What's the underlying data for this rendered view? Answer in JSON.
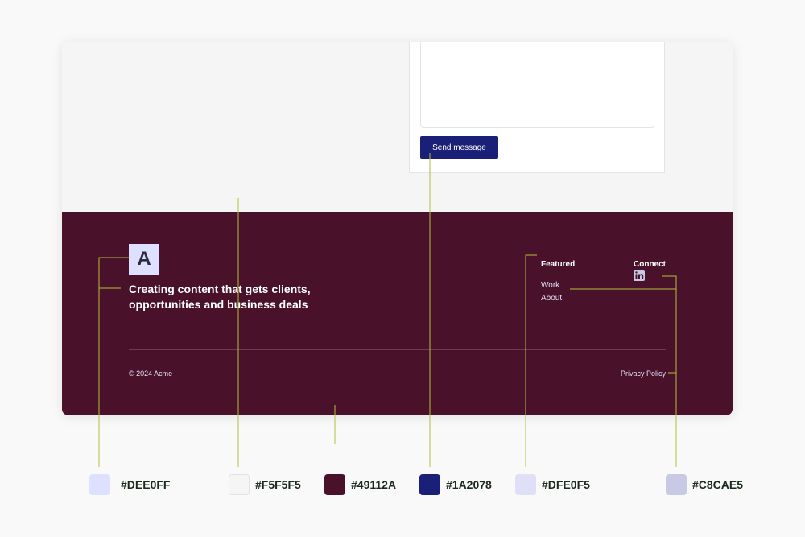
{
  "form": {
    "send_label": "Send message"
  },
  "footer": {
    "logo_letter": "A",
    "tagline_line1": "Creating content that gets clients,",
    "tagline_line2": "opportunities and business deals",
    "featured": {
      "title": "Featured",
      "links": [
        "Work",
        "About"
      ]
    },
    "connect": {
      "title": "Connect",
      "icon": "linkedin-icon"
    },
    "copyright": "© 2024 Acme",
    "privacy_label": "Privacy Policy"
  },
  "palette": [
    {
      "hex": "#DEE0FF",
      "label": "#DEE0FF"
    },
    {
      "hex": "#F5F5F5",
      "label": "#F5F5F5"
    },
    {
      "hex": "#49112A",
      "label": "#49112A"
    },
    {
      "hex": "#1A2078",
      "label": "#1A2078"
    },
    {
      "hex": "#DFE0F5",
      "label": "#DFE0F5"
    },
    {
      "hex": "#C8CAE5",
      "label": "#C8CAE5"
    }
  ],
  "colors": {
    "background": "#F9F9F9",
    "annotation_line": "#B5BE3A"
  }
}
